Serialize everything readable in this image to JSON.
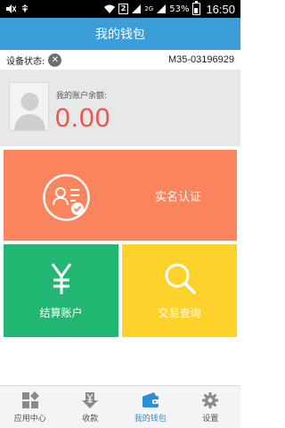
{
  "status_bar": {
    "sim_label": "2",
    "network_label": "2G",
    "battery": "53%",
    "time": "16:50"
  },
  "header": {
    "title": "我的钱包"
  },
  "device": {
    "status_label": "设备状态:",
    "status_icon": "close-icon",
    "device_id": "M35-03196929"
  },
  "balance": {
    "label": "我的账户余额:",
    "amount": "0.00",
    "amount_color": "#f0524e"
  },
  "tiles": {
    "identity": {
      "label": "实名认证",
      "icon": "id-card-verified-icon",
      "color": "#fa845d"
    },
    "settlement": {
      "label": "结算账户",
      "icon": "yen-icon",
      "color": "#21b672"
    },
    "query": {
      "label": "交易查询",
      "icon": "search-icon",
      "color": "#fdd22b"
    }
  },
  "bottom_nav": [
    {
      "label": "应用中心",
      "icon": "apps-icon",
      "active": false
    },
    {
      "label": "收款",
      "icon": "yen-download-icon",
      "active": false
    },
    {
      "label": "我的钱包",
      "icon": "wallet-icon",
      "active": true
    },
    {
      "label": "设置",
      "icon": "gear-icon",
      "active": false
    }
  ],
  "colors": {
    "header": "#3c9ed8",
    "nav_active": "#2a8fd6"
  }
}
